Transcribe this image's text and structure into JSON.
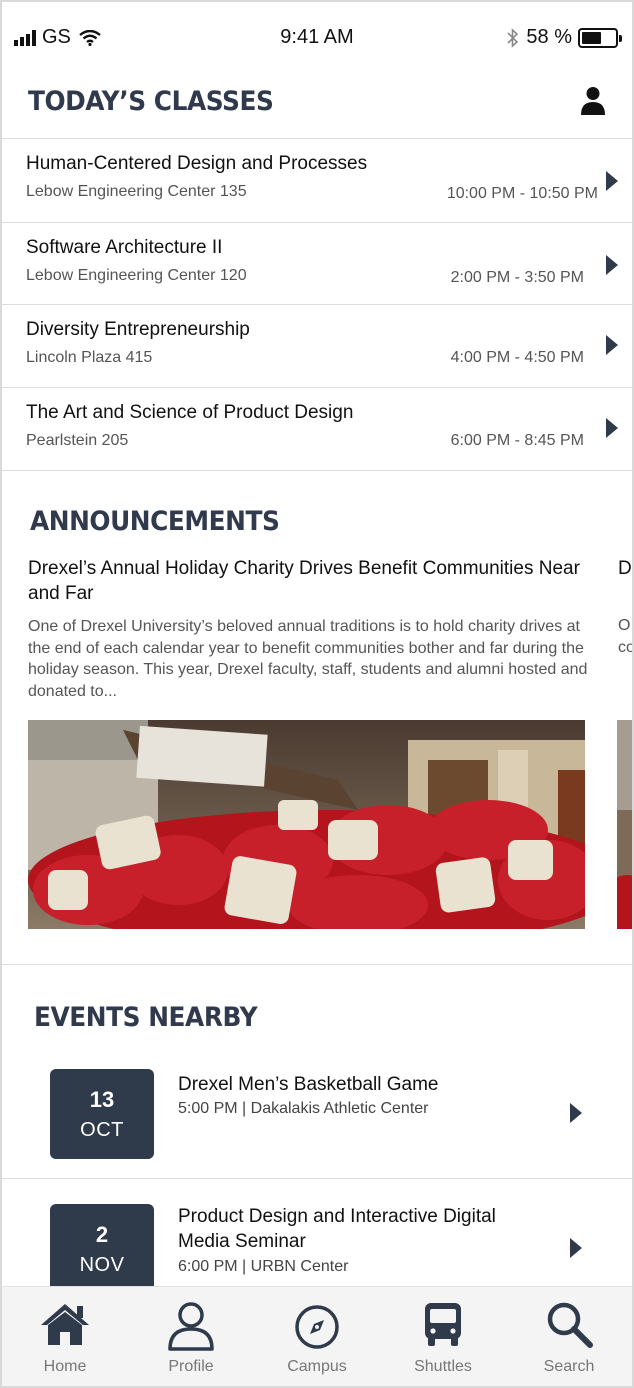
{
  "status_bar": {
    "carrier": "GS",
    "time": "9:41 AM",
    "battery": "58 %",
    "battery_level": 0.58
  },
  "classes": {
    "title": "TODAY’S CLASSES",
    "items": [
      {
        "name": "Human-Centered Design and Processes",
        "room": "Lebow Engineering Center 135",
        "time": "10:00 PM - 10:50 PM"
      },
      {
        "name": "Software Architecture II",
        "room": "Lebow Engineering Center 120",
        "time": "2:00 PM - 3:50 PM"
      },
      {
        "name": "Diversity Entrepreneurship",
        "room": "Lincoln Plaza 415",
        "time": "4:00 PM - 4:50 PM"
      },
      {
        "name": "The Art and Science of Product Design",
        "room": "Pearlstein 205",
        "time": "6:00 PM - 8:45 PM"
      }
    ]
  },
  "announcements": {
    "title": "ANNOUNCEMENTS",
    "items": [
      {
        "headline": "Drexel’s Annual Holiday Charity Drives Benefit Communities Near and Far",
        "body": "One of Drexel University’s beloved annual traditions is to hold charity drives at the end of each calendar year to benefit communities bother and far during the holiday season. This year, Drexel faculty, staff, students and alumni hosted and donated to..."
      }
    ],
    "peek_headline": "D C",
    "peek_body": "O ch co Dr"
  },
  "events": {
    "title": "EVENTS NEARBY",
    "items": [
      {
        "day": "13",
        "month": "OCT",
        "name": "Drexel Men’s Basketball Game",
        "meta": "5:00 PM | Dakalakis Athletic Center"
      },
      {
        "day": "2",
        "month": "NOV",
        "name": "Product Design and Interactive Digital Media Seminar",
        "meta": "6:00 PM | URBN Center"
      }
    ]
  },
  "tabbar": {
    "items": [
      {
        "label": "Home",
        "icon": "home-icon"
      },
      {
        "label": "Profile",
        "icon": "user-icon"
      },
      {
        "label": "Campus",
        "icon": "compass-icon"
      },
      {
        "label": "Shuttles",
        "icon": "bus-icon"
      },
      {
        "label": "Search",
        "icon": "search-icon"
      }
    ],
    "active_index": 0
  },
  "colors": {
    "navy": "#2f3a4b",
    "title": "#313a4d",
    "tab_active": "#2f3a4b",
    "tab_inactive": "#777777"
  }
}
